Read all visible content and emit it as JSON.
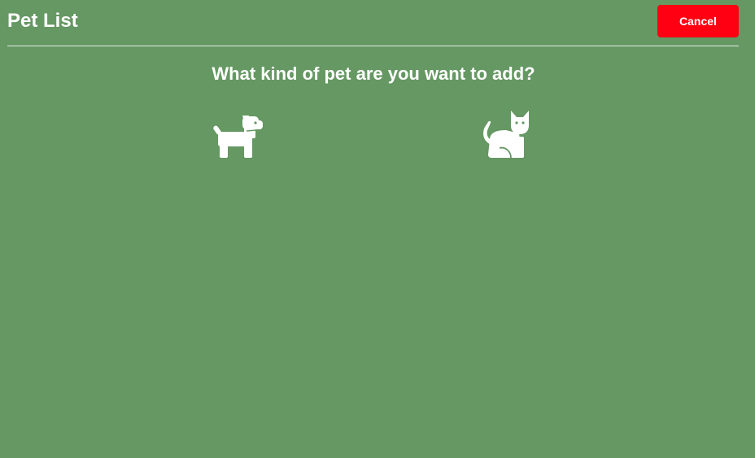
{
  "header": {
    "title": "Pet List",
    "cancel_label": "Cancel"
  },
  "main": {
    "question": "What kind of pet are you want to add?",
    "options": [
      {
        "icon": "dog-icon"
      },
      {
        "icon": "cat-icon"
      }
    ]
  },
  "colors": {
    "background": "#659862",
    "cancel_button": "#fe0012",
    "text": "#ffffff"
  }
}
